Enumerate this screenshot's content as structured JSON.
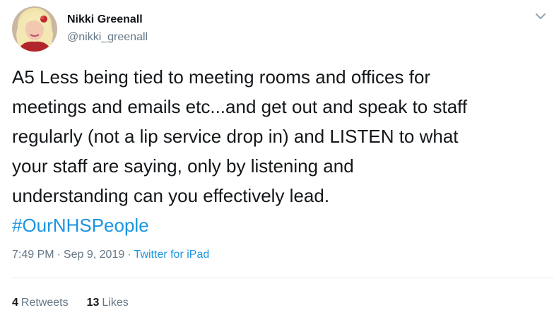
{
  "author": {
    "display_name": "Nikki Greenall",
    "handle": "@nikki_greenall",
    "avatar_icon": "profile-photo"
  },
  "menu_icon": "chevron-down-icon",
  "tweet": {
    "lines": [
      "A5 Less being tied to meeting rooms and offices for",
      "meetings and emails etc...and get out and speak to staff",
      "regularly (not a lip service drop in) and LISTEN to what",
      "your staff are saying, only by listening and",
      "understanding can you effectively lead."
    ],
    "hashtag": "#OurNHSPeople"
  },
  "meta": {
    "time": "7:49 PM",
    "separator": "·",
    "date": "Sep 9, 2019",
    "source": "Twitter for iPad"
  },
  "stats": {
    "retweets_count": "4",
    "retweets_label": "Retweets",
    "likes_count": "13",
    "likes_label": "Likes"
  },
  "colors": {
    "link": "#1b95e0",
    "secondary_text": "#657786",
    "divider": "#e6ecf0"
  }
}
